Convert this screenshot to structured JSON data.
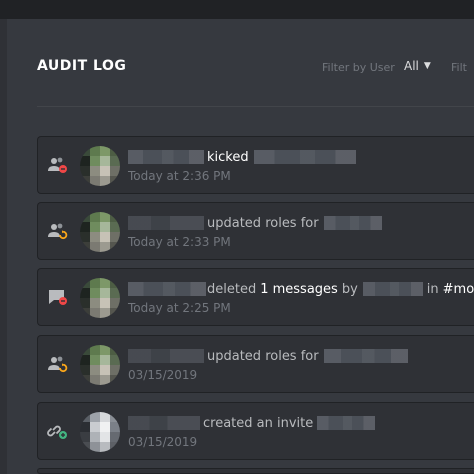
{
  "header": {
    "title": "AUDIT LOG",
    "filter_user_label": "Filter by User",
    "filter_user_value": "All",
    "filter_action_label": "Filt"
  },
  "entries": [
    {
      "type_icon": "member-kick-icon",
      "type_color": "#f04747",
      "action": "kicked",
      "time": "Today at 2:36 PM"
    },
    {
      "type_icon": "member-role-update-icon",
      "type_color": "#faa61a",
      "action": "updated roles for",
      "time": "Today at 2:33 PM"
    },
    {
      "type_icon": "message-delete-icon",
      "type_color": "#f04747",
      "action": "deleted",
      "count_text": "1 messages",
      "by_text": "by",
      "in_text": "in",
      "channel": "#mod",
      "time": "Today at 2:25 PM"
    },
    {
      "type_icon": "member-role-update-icon",
      "type_color": "#faa61a",
      "action": "updated roles for",
      "time": "03/15/2019"
    },
    {
      "type_icon": "invite-create-icon",
      "type_color": "#43b581",
      "action": "created an invite",
      "time": "03/15/2019"
    }
  ],
  "colors": {
    "background": "#36393f",
    "card": "#2f3136",
    "title": "#ffffff",
    "muted": "#72767d",
    "danger": "#f04747",
    "warning": "#faa61a",
    "success": "#43b581"
  }
}
